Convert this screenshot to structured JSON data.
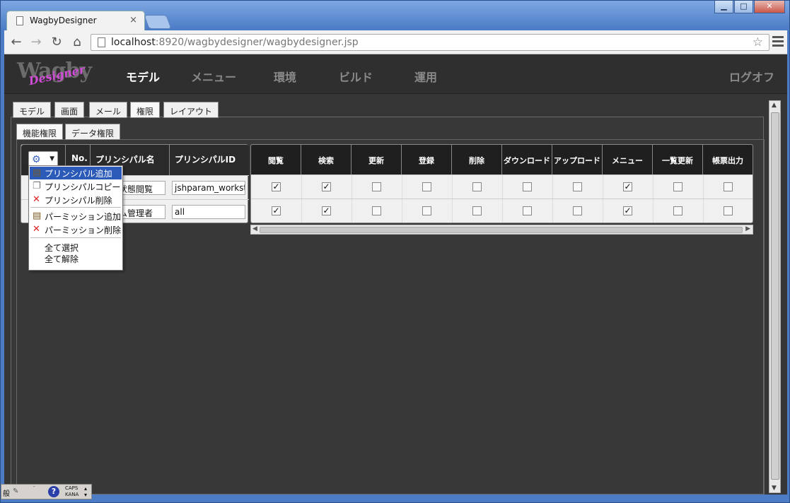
{
  "browser": {
    "tab_title": "WagbyDesigner",
    "tab_close": "×",
    "url_host": "localhost",
    "url_rest": ":8920/wagbydesigner/wagbydesigner.jsp",
    "win_min": "▁",
    "win_max": "□",
    "win_close": "✕"
  },
  "app": {
    "logo_main": "Wagby",
    "logo_sub": "Designer",
    "nav": [
      "モデル",
      "メニュー",
      "環境",
      "ビルド",
      "運用"
    ],
    "logoff": "ログオフ"
  },
  "tabs_top": [
    "モデル",
    "画面",
    "メール",
    "権限",
    "レイアウト"
  ],
  "tabs_sub": [
    "機能権限",
    "データ権限"
  ],
  "left_headers": [
    "No.",
    "プリンシパル名",
    "プリンシパルID"
  ],
  "rows": [
    {
      "name_visible": "状態閲覧",
      "id": "jshparam_workst",
      "perms": [
        true,
        true,
        false,
        false,
        false,
        false,
        false,
        true,
        false,
        false
      ]
    },
    {
      "name_visible": "ム管理者",
      "id": "all",
      "perms": [
        true,
        true,
        false,
        false,
        false,
        false,
        false,
        true,
        false,
        false
      ]
    }
  ],
  "perm_headers": [
    "閲覧",
    "検索",
    "更新",
    "登録",
    "削除",
    "ダウンロード",
    "アップロード",
    "メニュー",
    "一覧更新",
    "帳票出力"
  ],
  "menu": {
    "items": [
      {
        "label": "プリンシパル追加",
        "icon": "add-icon",
        "highlight": true
      },
      {
        "label": "プリンシパルコピー",
        "icon": "copy-icon",
        "highlight": false
      },
      {
        "label": "プリンシパル削除",
        "icon": "delete-icon",
        "highlight": false
      },
      {
        "label": "パーミッション追加",
        "icon": "add-icon",
        "highlight": false
      },
      {
        "label": "パーミッション削除",
        "icon": "delete-icon",
        "highlight": false
      },
      {
        "label": "全て選択",
        "icon": "",
        "highlight": false
      },
      {
        "label": "全て解除",
        "icon": "",
        "highlight": false
      }
    ]
  },
  "ime": {
    "caps": "CAPS",
    "kana": "KANA",
    "help": "?"
  },
  "colors": {
    "accent": "#2b5ab8",
    "header_bg": "#2f2f2f",
    "content_bg": "#363636"
  }
}
